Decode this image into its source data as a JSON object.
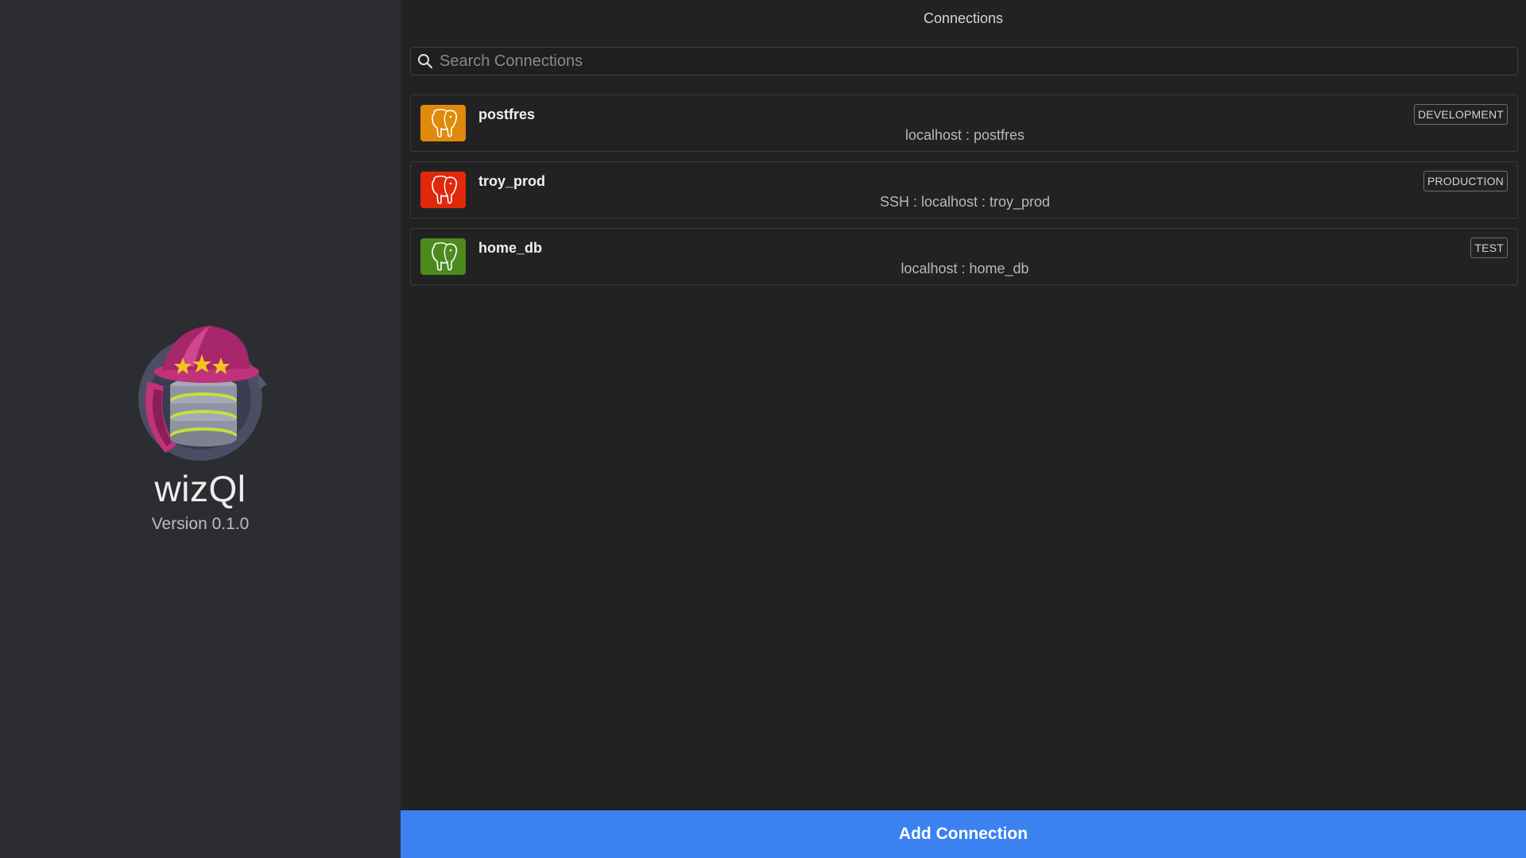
{
  "sidebar": {
    "app_name": "wizQl",
    "version": "Version 0.1.0",
    "logo_icon": "wizard-database-logo-icon"
  },
  "main": {
    "title": "Connections",
    "search": {
      "placeholder": "Search Connections",
      "value": "",
      "icon": "search-icon"
    },
    "connections": [
      {
        "name": "postfres",
        "host": "localhost : postfres",
        "tag": "DEVELOPMENT",
        "color": "#e08a0c",
        "icon": "postgres-elephant-icon"
      },
      {
        "name": "troy_prod",
        "host": "SSH : localhost : troy_prod",
        "tag": "PRODUCTION",
        "color": "#e0290c",
        "icon": "postgres-elephant-icon"
      },
      {
        "name": "home_db",
        "host": "localhost : home_db",
        "tag": "TEST",
        "color": "#4d8a1e",
        "icon": "postgres-elephant-icon"
      }
    ],
    "add_button_label": "Add Connection"
  },
  "colors": {
    "accent": "#3b82f0",
    "sidebar_bg": "#2c2d30",
    "main_bg": "#222223"
  }
}
